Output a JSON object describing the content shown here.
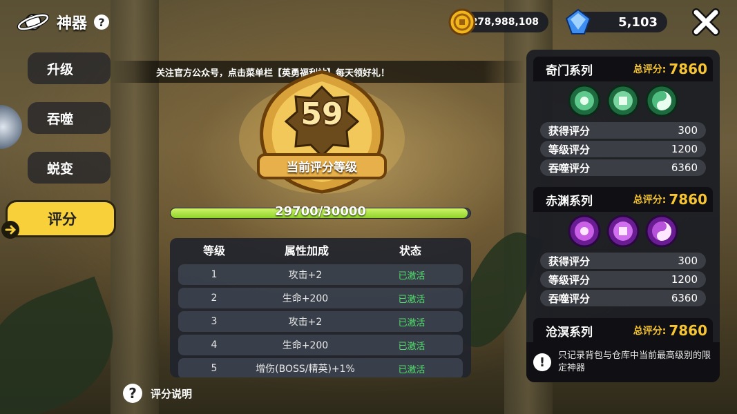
{
  "header": {
    "title": "神器",
    "help_icon": "?"
  },
  "resources": {
    "gold": "278,988,108",
    "gems": "5,103"
  },
  "menu": {
    "items": [
      {
        "label": "升级"
      },
      {
        "label": "吞噬"
      },
      {
        "label": "蜕变"
      },
      {
        "label": "评分"
      }
    ],
    "active_index": 3
  },
  "marquee": {
    "text": "关注官方公众号，点击菜单栏【英勇福利站】每天领好礼！"
  },
  "level": {
    "value": "59",
    "label": "当前评分等级"
  },
  "progress": {
    "text": "29700/30000",
    "current": 29700,
    "max": 30000
  },
  "level_table": {
    "headers": {
      "level": "等级",
      "bonus": "属性加成",
      "status": "状态"
    },
    "rows": [
      {
        "level": "1",
        "bonus": "攻击+2",
        "status": "已激活"
      },
      {
        "level": "2",
        "bonus": "生命+200",
        "status": "已激活"
      },
      {
        "level": "3",
        "bonus": "攻击+2",
        "status": "已激活"
      },
      {
        "level": "4",
        "bonus": "生命+200",
        "status": "已激活"
      },
      {
        "level": "5",
        "bonus": "增伤(BOSS/精英)+1%",
        "status": "已激活"
      }
    ]
  },
  "explain": {
    "icon": "?",
    "label": "评分说明"
  },
  "series": [
    {
      "name": "奇门系列",
      "total_label": "总评分:",
      "total": "7860",
      "color": "#2f9a5c",
      "stats": [
        {
          "label": "获得评分",
          "value": "300"
        },
        {
          "label": "等级评分",
          "value": "1200"
        },
        {
          "label": "吞噬评分",
          "value": "6360"
        }
      ]
    },
    {
      "name": "赤渊系列",
      "total_label": "总评分:",
      "total": "7860",
      "color": "#9b2fd1",
      "stats": [
        {
          "label": "获得评分",
          "value": "300"
        },
        {
          "label": "等级评分",
          "value": "1200"
        },
        {
          "label": "吞噬评分",
          "value": "6360"
        }
      ]
    },
    {
      "name": "沧溟系列",
      "total_label": "总评分:",
      "total": "7860"
    }
  ],
  "notice": {
    "icon": "!",
    "text": "只记录背包与仓库中当前最高级别的限定神器"
  },
  "colors": {
    "accent": "#f7d03a",
    "activated": "#4fe06a",
    "score": "#f7c531"
  }
}
